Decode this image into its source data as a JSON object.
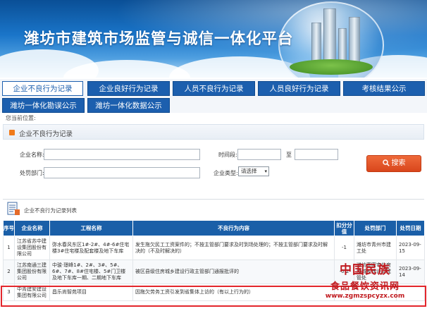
{
  "header": {
    "title": "潍坊市建筑市场监管与诚信一体化平台"
  },
  "nav": {
    "tabs": [
      {
        "label": "企业不良行为记录",
        "active": true
      },
      {
        "label": "企业良好行为记录",
        "active": false
      },
      {
        "label": "人员不良行为记录",
        "active": false
      },
      {
        "label": "人员良好行为记录",
        "active": false
      },
      {
        "label": "考核结果公示",
        "active": false
      },
      {
        "label": "潍坊一体化勘误公示",
        "active": false
      },
      {
        "label": "潍坊一体化数据公示",
        "active": false
      }
    ]
  },
  "location": {
    "label": "您当前位置:"
  },
  "section": {
    "title": "企业不良行为记录"
  },
  "search": {
    "company_label": "企业名称:",
    "company_value": "",
    "time_label": "时间段:",
    "time_to": "至",
    "time_from_value": "",
    "time_to_value": "",
    "dept_label": "处罚部门:",
    "dept_value": "",
    "type_label": "企业类型:",
    "type_selected": "请选择",
    "button_label": "搜索"
  },
  "list": {
    "title": "企业不良行为记录列表",
    "columns": [
      "序号",
      "企业名称",
      "工程名称",
      "不良行为内容",
      "扣分分值",
      "处罚部门",
      "处罚日期"
    ],
    "rows": [
      {
        "no": "1",
        "company": "江苏省苏中建设集团股份有限公司",
        "project": "弥水春风东区1#-2#、4#-6#住宅楼3#住宅楼及配套楼及地下车库",
        "content": "发生拖欠民工工资案件的；不按主管部门要求及时到场处理的；不按主管部门要求及时解决的（不及时解决的）",
        "score": "-1",
        "dept": "潍坊市青州市建工处",
        "date": "2023-09-15"
      },
      {
        "no": "2",
        "company": "江苏南通三建集团股份有限公司",
        "project": "中骏·璟峰1#、2#、3#、5#、6#、7#、8#住宅楼、5#门卫楼及地下车库一期、二期地下车库",
        "content": "被区县级住房城乡建设行政主管部门通报批评的",
        "score": "-0.2",
        "dept": "潍坊高密市住房和城乡建设局建管处",
        "date": "2023-09-14"
      },
      {
        "no": "3",
        "company": "中青建安建设集团有限公司",
        "project": "昌乐尚智苑项目",
        "content": "因拖欠劳务工资引发到省集体上访的（有以上行为的）",
        "score": "",
        "dept": "",
        "date": ""
      }
    ]
  },
  "watermark": {
    "line1": "中国民族",
    "line2": "食品餐饮资讯网",
    "line3": "www.zgmzspcyzx.com"
  },
  "colors": {
    "nav_blue": "#1c5fae",
    "header_blue": "#1a5fa8",
    "search_orange": "#e0532a",
    "highlight_red": "#e3262c",
    "watermark_red": "#c0191e"
  }
}
